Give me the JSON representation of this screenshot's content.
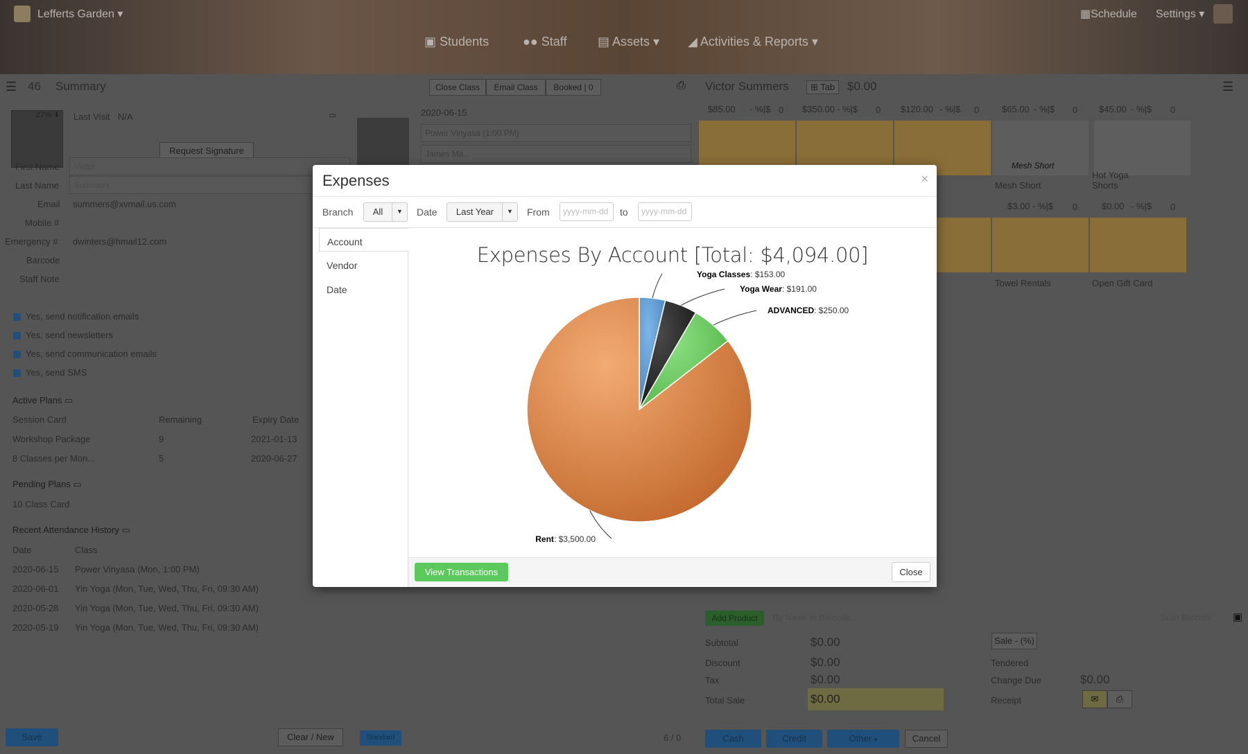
{
  "header": {
    "studio": "Lefferts Garden",
    "nav": [
      "Students",
      "Staff",
      "Assets",
      "Activities & Reports"
    ],
    "schedule": "Schedule",
    "settings": "Settings"
  },
  "left": {
    "count": "46",
    "title": "Summary",
    "photo_pct": "27%",
    "last_visit_label": "Last Visit",
    "last_visit_value": "N/A",
    "request_signature": "Request Signature",
    "fields": [
      {
        "label": "First Name",
        "placeholder": "Victor"
      },
      {
        "label": "Last Name",
        "placeholder": "Summers"
      },
      {
        "label": "Email",
        "value": "summers@xvmail.us.com"
      },
      {
        "label": "Mobile #",
        "value": ""
      },
      {
        "label": "Emergency #",
        "value": "dwinters@hmail12.com"
      },
      {
        "label": "Barcode",
        "value": ""
      },
      {
        "label": "Staff Note",
        "value": ""
      }
    ],
    "checks": [
      "Yes, send notification emails",
      "Yes, send newsletters",
      "Yes, send communication emails",
      "Yes, send SMS"
    ],
    "active_plans_title": "Active Plans",
    "plans_headers": [
      "Session Card",
      "Remaining",
      "Expiry Date"
    ],
    "plans": [
      {
        "name": "Workshop Package",
        "remaining": "9",
        "expiry": "2021-01-13"
      },
      {
        "name": "8 Classes per Mon...",
        "remaining": "5",
        "expiry": "2020-06-27"
      }
    ],
    "pending_title": "Pending Plans",
    "pending": [
      "10 Class Card"
    ],
    "history_title": "Recent Attendance History",
    "history_headers": [
      "Date",
      "Class"
    ],
    "history": [
      {
        "date": "2020-06-15",
        "cls": "Power Vinyasa (Mon, 1:00 PM)"
      },
      {
        "date": "2020-06-01",
        "cls": "Yin Yoga (Mon, Tue, Wed, Thu, Fri, 09:30 AM)"
      },
      {
        "date": "2020-05-28",
        "cls": "Yin Yoga (Mon, Tue, Wed, Thu, Fri, 09:30 AM)"
      },
      {
        "date": "2020-05-19",
        "cls": "Yin Yoga (Mon, Tue, Wed, Thu, Fri, 09:30 AM)"
      }
    ],
    "save": "Save",
    "clear_new": "Clear / New"
  },
  "middle": {
    "buttons": [
      "Close Class",
      "Email Class",
      "Booked | 0"
    ],
    "date": "2020-06-15",
    "cls": "Power Vinyasa (1:00 PM)",
    "instructor": "James Ma...",
    "standard": "Standard",
    "paging": "6 / 0"
  },
  "right": {
    "name": "Victor Summers",
    "tab_label": "Tab",
    "balance": "$0.00",
    "prices_row1": [
      "$85.00",
      "$350.00",
      "$120.00",
      "$65.00",
      "$45.00"
    ],
    "price_suffix": "- %|$",
    "qty": "0",
    "mesh_short": "Mesh Short",
    "hot_yoga_shorts": "Hot Yoga Shorts",
    "prices_row2": [
      "$3.00",
      "$0.00"
    ],
    "towel": "Towel Rentals",
    "gift": "Open Gift Card",
    "add_product": "Add Product",
    "search_placeholder": "By Name or Barcode...",
    "scan": "Scan Barcode",
    "totals": [
      {
        "label": "Subtotal",
        "value": "$0.00"
      },
      {
        "label": "Discount",
        "value": "$0.00"
      },
      {
        "label": "Tax",
        "value": "$0.00"
      },
      {
        "label": "Total Sale",
        "value": "$0.00"
      }
    ],
    "sale_dd": "Sale - (%)",
    "tendered": "Tendered",
    "change_due": "Change Due",
    "change_value": "$0.00",
    "receipt": "Receipt",
    "pay": [
      "Cash",
      "Credit",
      "Other",
      "Cancel"
    ]
  },
  "modal": {
    "title": "Expenses",
    "close_x": "×",
    "branch_label": "Branch",
    "branch_value": "All",
    "date_label": "Date",
    "date_value": "Last Year",
    "from_label": "From",
    "from_placeholder": "yyyy-mm-dd",
    "to_label": "to",
    "to_placeholder": "yyyy-mm-dd",
    "tabs": [
      "Account",
      "Vendor",
      "Date"
    ],
    "view_transactions": "View Transactions",
    "close": "Close"
  },
  "chart_data": {
    "type": "pie",
    "title": "Expenses By Account [Total: $4,094.00]",
    "slices": [
      {
        "label": "Yoga Classes",
        "value": 153.0,
        "display": "$153.00",
        "color": "#5b9bd5"
      },
      {
        "label": "Yoga Wear",
        "value": 191.0,
        "display": "$191.00",
        "color": "#2c2c2c"
      },
      {
        "label": "ADVANCED",
        "value": 250.0,
        "display": "$250.00",
        "color": "#6ccb62"
      },
      {
        "label": "Rent",
        "value": 3500.0,
        "display": "$3,500.00",
        "color": "#d9864a"
      }
    ]
  }
}
